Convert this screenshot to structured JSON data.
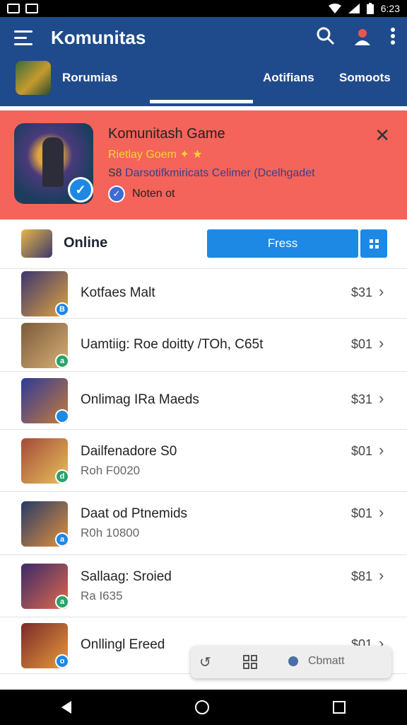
{
  "status_bar": {
    "time": "6:23"
  },
  "app_bar": {
    "title": "Komunitas",
    "tabs": [
      {
        "label": "Rorumias"
      },
      {
        "label": "Aotifians"
      },
      {
        "label": "Somoots"
      }
    ]
  },
  "banner": {
    "title": "Komunitash Game",
    "subtitle": "Rietlay Goem ✦ ★",
    "desc_prefix": "S8",
    "desc_text": "Darsotifkmiricats Celimer (Dcelhgadet",
    "note": "Noten ot",
    "close_glyph": "✕"
  },
  "online_row": {
    "label": "Online",
    "button_label": "Fress"
  },
  "list": {
    "items": [
      {
        "title": "Kotfaes Malt",
        "subtitle": "",
        "price": "$31",
        "badge": "B",
        "colors": [
          "#3b3570",
          "#e1a440"
        ]
      },
      {
        "title": "Uamtiig: Roe doitty /TOh, C65t",
        "subtitle": "",
        "price": "$01",
        "badge": "a",
        "colors": [
          "#7a5a3a",
          "#d9b076"
        ]
      },
      {
        "title": "Onlimag IRa Maeds",
        "subtitle": "",
        "price": "$31",
        "badge": "",
        "colors": [
          "#2c3a9a",
          "#c87b3a"
        ]
      },
      {
        "title": "Dailfenadore S0",
        "subtitle": "Roh F0020",
        "price": "$01",
        "badge": "d",
        "colors": [
          "#a4493a",
          "#e8c25a"
        ]
      },
      {
        "title": "Daat od Ptnemids",
        "subtitle": "R0h 10800",
        "price": "$01",
        "badge": "a",
        "colors": [
          "#273a6a",
          "#e2923a"
        ]
      },
      {
        "title": "Sallaag: Sroied",
        "subtitle": "Ra I635",
        "price": "$81",
        "badge": "a",
        "colors": [
          "#3b2a6a",
          "#e06a4a"
        ]
      },
      {
        "title": "Onllingl Ereed",
        "subtitle": "",
        "price": "$01",
        "badge": "o",
        "colors": [
          "#7a2a2a",
          "#e99a3a"
        ]
      }
    ]
  },
  "floating_bar": {
    "label": "Cbmatt"
  }
}
